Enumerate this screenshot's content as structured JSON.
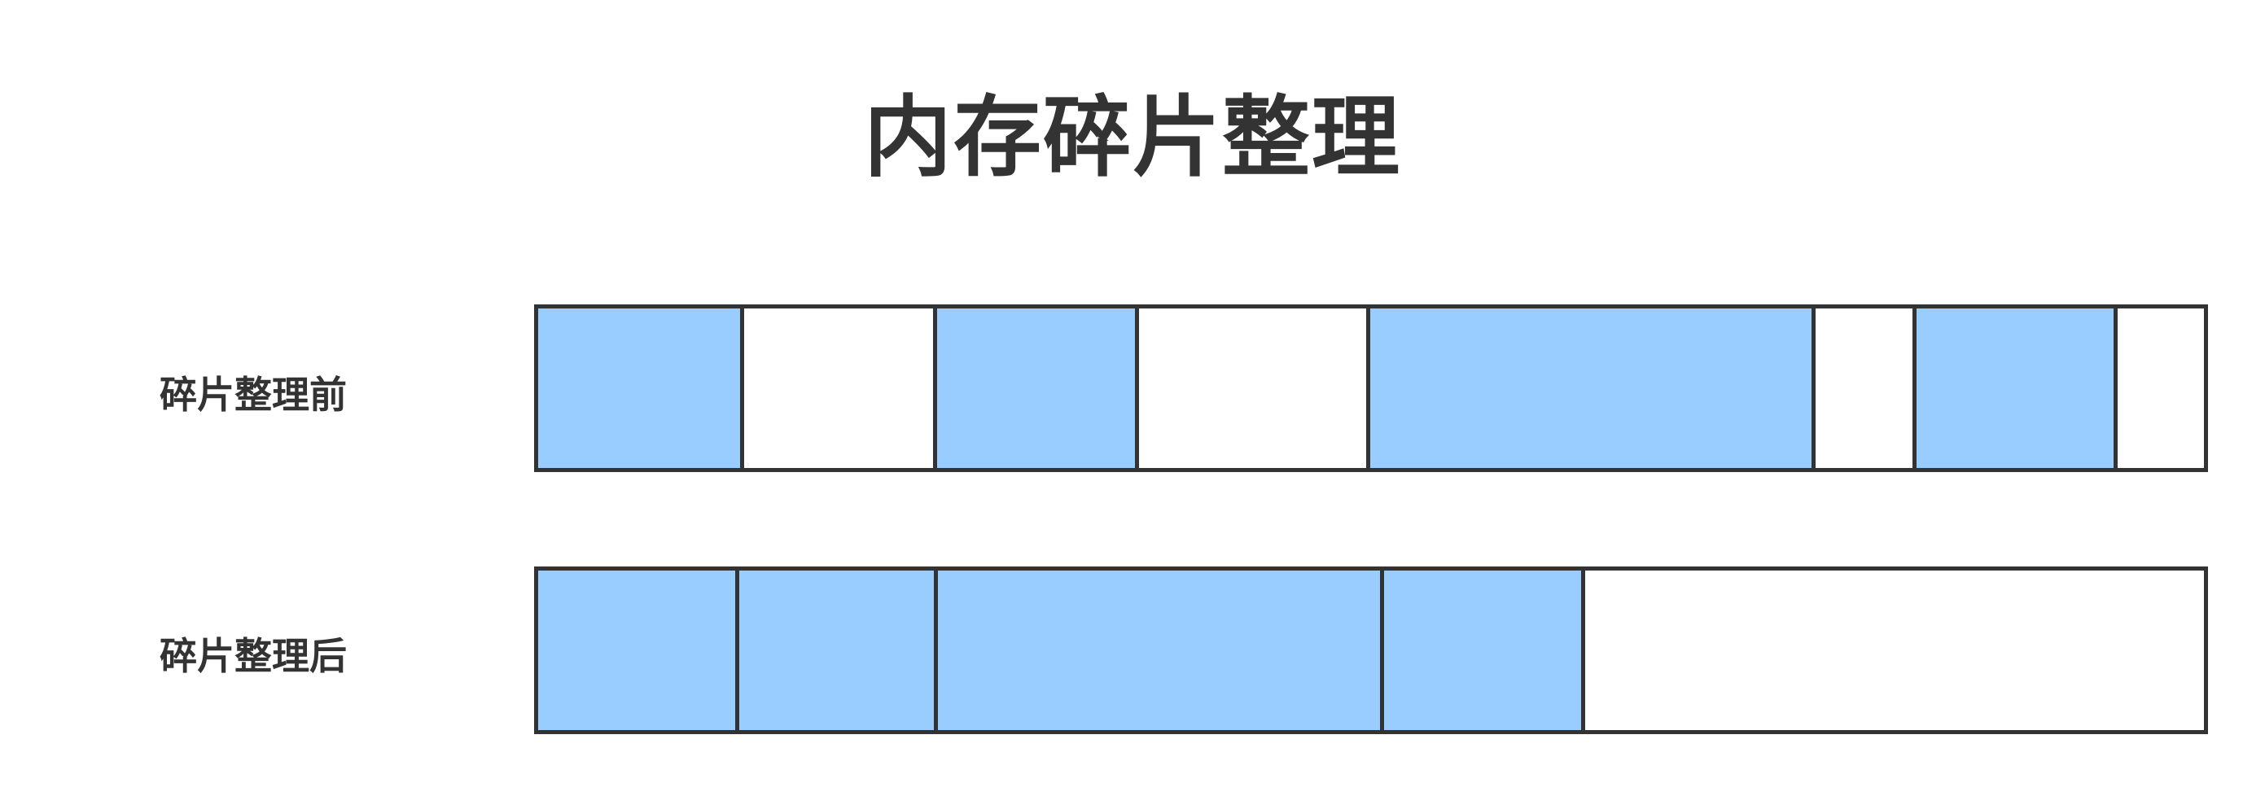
{
  "title": "内存碎片整理",
  "rows": {
    "before": {
      "label": "碎片整理前",
      "segments": [
        "used",
        "free",
        "used",
        "free",
        "used",
        "free",
        "used",
        "free"
      ]
    },
    "after": {
      "label": "碎片整理后",
      "segments": [
        "used",
        "used",
        "used",
        "used",
        "free"
      ]
    }
  },
  "colors": {
    "used": "#99ccff",
    "free": "#ffffff",
    "border": "#333333",
    "text": "#333333"
  }
}
